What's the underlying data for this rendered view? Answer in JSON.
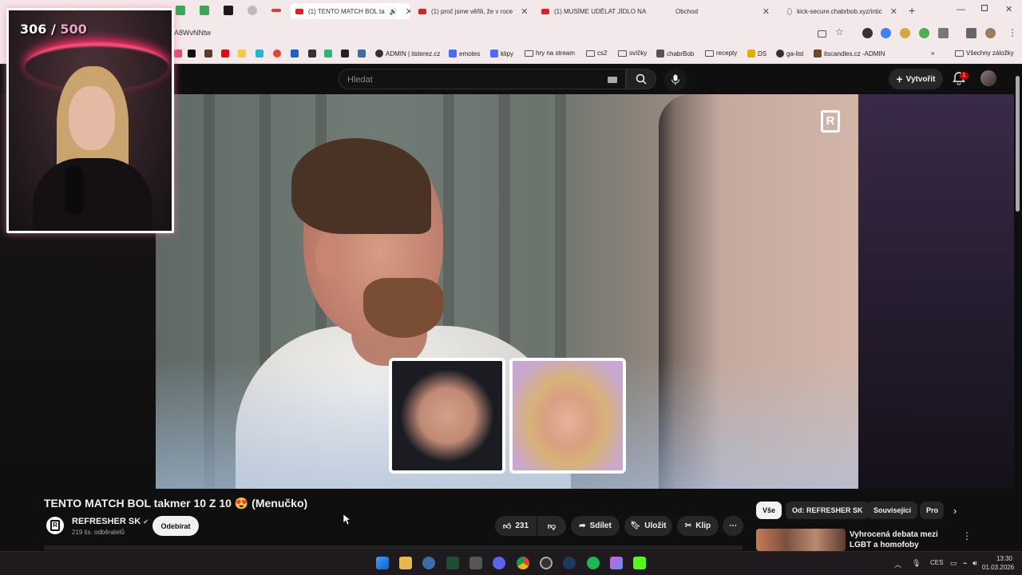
{
  "browser": {
    "tabs": [
      {
        "label": "(1) TENTO MATCH BOL ta",
        "active": true
      },
      {
        "label": "(1) proč jsme věřili, že v roce"
      },
      {
        "label": "(1) MUSÍME UDĚLAT JÍDLO NA"
      },
      {
        "label": "Obchod"
      },
      {
        "label": "kick-secure.chabrbob.xyz/intic"
      }
    ],
    "url": "A8WvNNtw",
    "bookmarks": [
      "ADMIN | itsterez.cz",
      "emotes",
      "klipy",
      "hry na stream",
      "cs2",
      "svíčky",
      "chabrBob",
      "recepty",
      "DS",
      "ga-list",
      "itscandles.cz -ADMIN"
    ],
    "all_bookmarks": "Všechny záložky"
  },
  "header": {
    "search_placeholder": "Hledat",
    "create_label": "Vytvořit",
    "notif_count": "1"
  },
  "overlay": {
    "count": "306",
    "separator": "/",
    "max": "500"
  },
  "video": {
    "title": "TENTO MATCH BOL takmer 10 Z 10 😍 (Menučko)",
    "channel_name": "REFRESHER SK",
    "subscribers": "219 tis. odběratelů",
    "subscribe_label": "Odebírat",
    "likes": "231",
    "share_label": "Sdílet",
    "save_label": "Uložit",
    "clip_label": "Klip"
  },
  "sidebar": {
    "chips": [
      "Vše",
      "Od: REFRESHER SK",
      "Související",
      "Pro"
    ],
    "rec_title": "Vyhrocená debata mezi LGBT a homofoby"
  },
  "taskbar": {
    "lang": "CES",
    "time": "13:30",
    "date": "01.03.2026"
  },
  "colors": {
    "yt_bg": "#0f0f0f",
    "chrome_bg": "#f3e8ea",
    "accent_red": "#cc0000",
    "overlay_pink": "#e7a6c3"
  }
}
